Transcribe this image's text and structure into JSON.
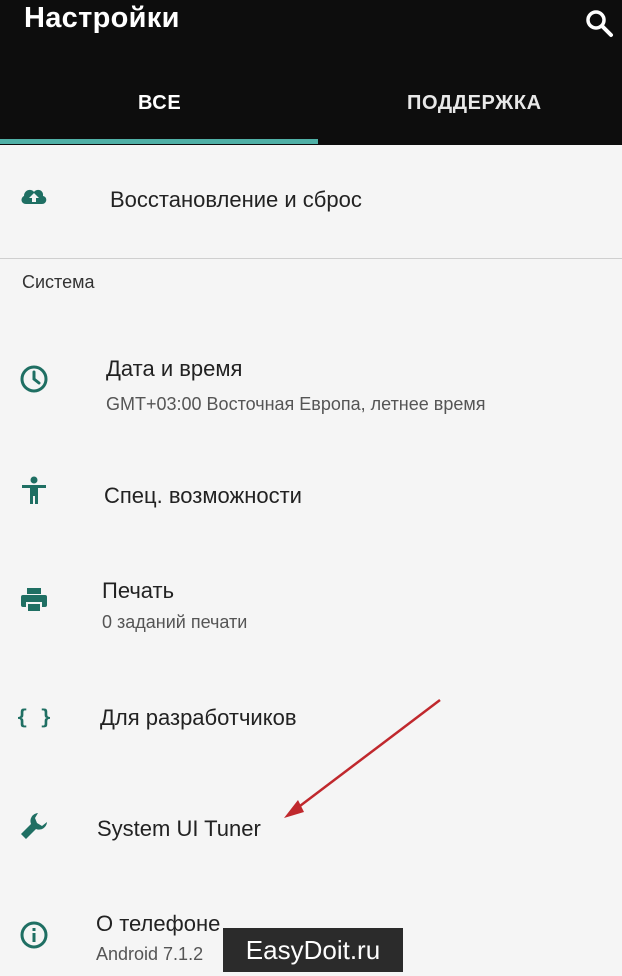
{
  "header": {
    "title": "Настройки",
    "tabs": [
      {
        "label": "ВСЕ",
        "selected": true
      },
      {
        "label": "ПОДДЕРЖКА",
        "selected": false
      }
    ],
    "accent": "#4fb0a6"
  },
  "top_item": {
    "label": "Восстановление и сброс",
    "icon": "cloud-upload-icon"
  },
  "section": {
    "title": "Система"
  },
  "items": [
    {
      "label": "Дата и время",
      "sub": "GMT+03:00 Восточная Европа, летнее время",
      "icon": "clock-icon"
    },
    {
      "label": "Спец. возможности",
      "sub": "",
      "icon": "accessibility-icon"
    },
    {
      "label": "Печать",
      "sub": "0 заданий печати",
      "icon": "printer-icon"
    },
    {
      "label": "Для разработчиков",
      "sub": "",
      "icon": "braces-icon"
    },
    {
      "label": "System UI Tuner",
      "sub": "",
      "icon": "wrench-icon"
    },
    {
      "label": "О телефоне",
      "sub": "Android 7.1.2",
      "icon": "info-icon"
    }
  ],
  "watermark": "EasyDoit.ru",
  "icon_color": "#1f6f63"
}
